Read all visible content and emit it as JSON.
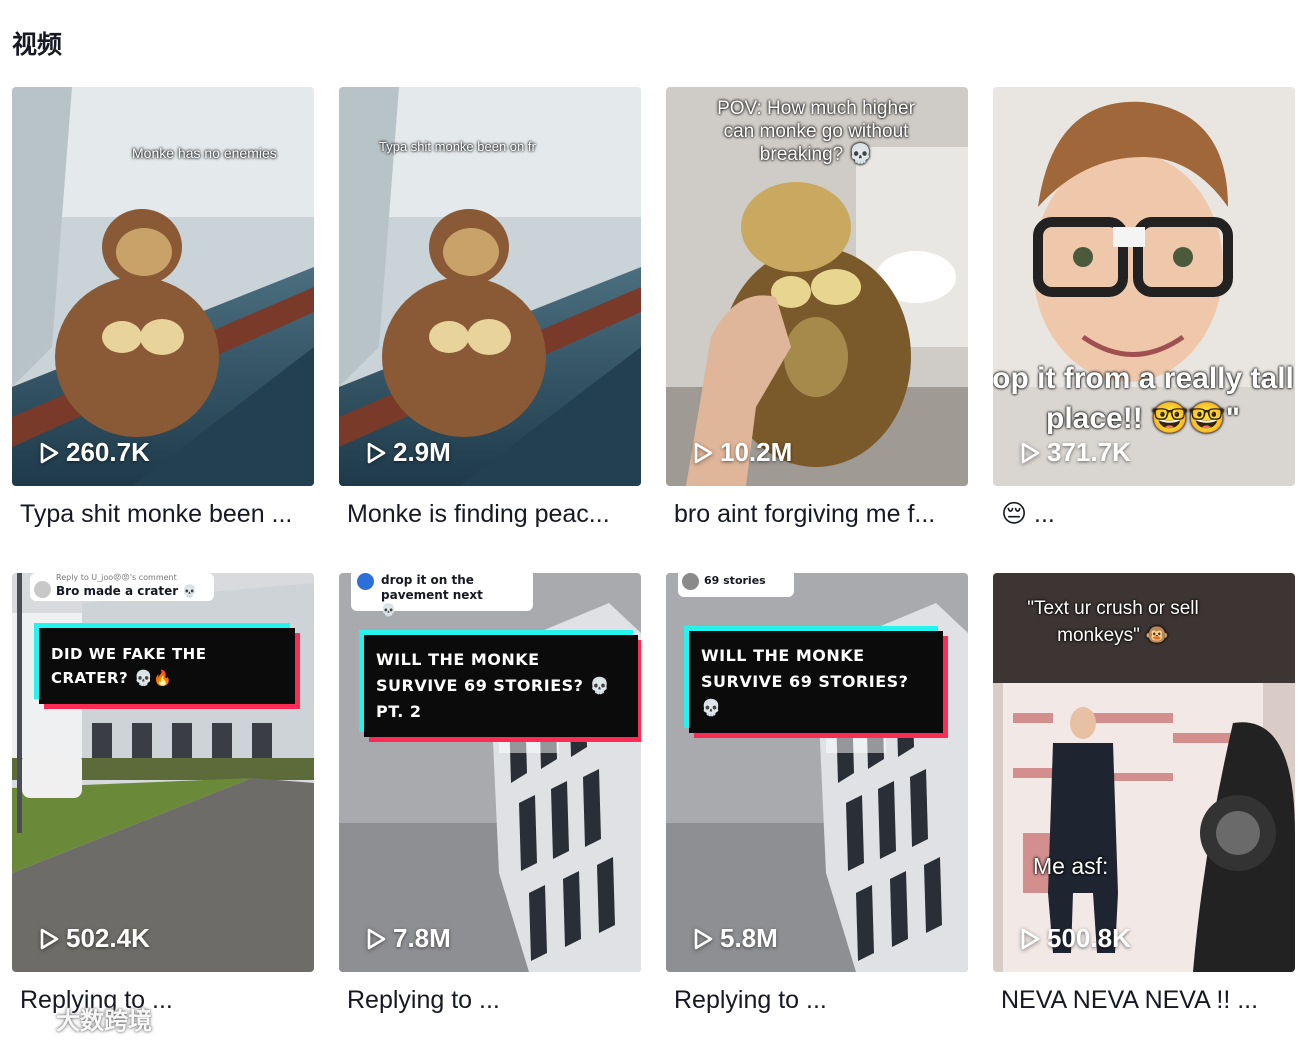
{
  "section": {
    "title": "视频"
  },
  "videos": [
    {
      "views": "260.7K",
      "caption": "Typa shit monke been ...",
      "overlay": "Monke has no enemies"
    },
    {
      "views": "2.9M",
      "caption": "Monke is finding peac...",
      "overlay": "Typa shit monke been on fr"
    },
    {
      "views": "10.2M",
      "caption": "bro aint forgiving me f...",
      "overlay": "POV: How much higher can monke go without breaking? 💀"
    },
    {
      "views": "371.7K",
      "caption": "😔 ...",
      "overlay": "op it from a really tall place!! 🤓🤓\""
    },
    {
      "views": "502.4K",
      "caption": "Replying to ...",
      "reply": "Reply to U_joo😡😡's comment",
      "reply_text": "Bro made a crater 💀",
      "banner": "DID WE FAKE THE CRATER? 💀🔥"
    },
    {
      "views": "7.8M",
      "caption": "Replying to ...",
      "reply_text": "drop it on the pavement next 💀",
      "banner": "WILL THE MONKE SURVIVE 69 STORIES? 💀 PT. 2"
    },
    {
      "views": "5.8M",
      "caption": "Replying to ...",
      "reply_text": "69 stories",
      "banner": "WILL THE MONKE SURVIVE 69 STORIES? 💀"
    },
    {
      "views": "500.8K",
      "caption": "NEVA NEVA NEVA !! ...",
      "overlay": "\"Text ur crush or sell monkeys\" 🐵",
      "overlay2": "Me asf:"
    }
  ],
  "watermark": {
    "text": "大数跨境"
  }
}
